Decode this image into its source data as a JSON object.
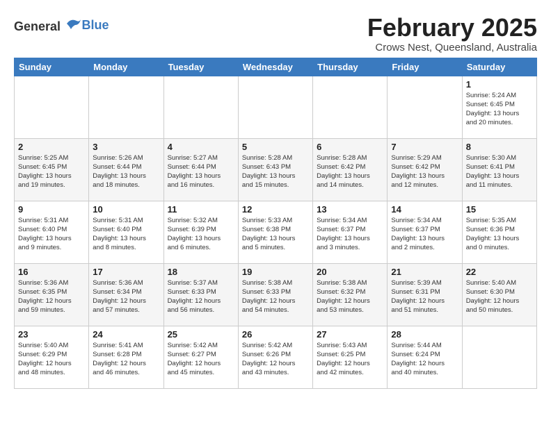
{
  "header": {
    "logo_general": "General",
    "logo_blue": "Blue",
    "month": "February 2025",
    "location": "Crows Nest, Queensland, Australia"
  },
  "columns": [
    "Sunday",
    "Monday",
    "Tuesday",
    "Wednesday",
    "Thursday",
    "Friday",
    "Saturday"
  ],
  "weeks": [
    [
      {
        "day": "",
        "detail": ""
      },
      {
        "day": "",
        "detail": ""
      },
      {
        "day": "",
        "detail": ""
      },
      {
        "day": "",
        "detail": ""
      },
      {
        "day": "",
        "detail": ""
      },
      {
        "day": "",
        "detail": ""
      },
      {
        "day": "1",
        "detail": "Sunrise: 5:24 AM\nSunset: 6:45 PM\nDaylight: 13 hours\nand 20 minutes."
      }
    ],
    [
      {
        "day": "2",
        "detail": "Sunrise: 5:25 AM\nSunset: 6:45 PM\nDaylight: 13 hours\nand 19 minutes."
      },
      {
        "day": "3",
        "detail": "Sunrise: 5:26 AM\nSunset: 6:44 PM\nDaylight: 13 hours\nand 18 minutes."
      },
      {
        "day": "4",
        "detail": "Sunrise: 5:27 AM\nSunset: 6:44 PM\nDaylight: 13 hours\nand 16 minutes."
      },
      {
        "day": "5",
        "detail": "Sunrise: 5:28 AM\nSunset: 6:43 PM\nDaylight: 13 hours\nand 15 minutes."
      },
      {
        "day": "6",
        "detail": "Sunrise: 5:28 AM\nSunset: 6:42 PM\nDaylight: 13 hours\nand 14 minutes."
      },
      {
        "day": "7",
        "detail": "Sunrise: 5:29 AM\nSunset: 6:42 PM\nDaylight: 13 hours\nand 12 minutes."
      },
      {
        "day": "8",
        "detail": "Sunrise: 5:30 AM\nSunset: 6:41 PM\nDaylight: 13 hours\nand 11 minutes."
      }
    ],
    [
      {
        "day": "9",
        "detail": "Sunrise: 5:31 AM\nSunset: 6:40 PM\nDaylight: 13 hours\nand 9 minutes."
      },
      {
        "day": "10",
        "detail": "Sunrise: 5:31 AM\nSunset: 6:40 PM\nDaylight: 13 hours\nand 8 minutes."
      },
      {
        "day": "11",
        "detail": "Sunrise: 5:32 AM\nSunset: 6:39 PM\nDaylight: 13 hours\nand 6 minutes."
      },
      {
        "day": "12",
        "detail": "Sunrise: 5:33 AM\nSunset: 6:38 PM\nDaylight: 13 hours\nand 5 minutes."
      },
      {
        "day": "13",
        "detail": "Sunrise: 5:34 AM\nSunset: 6:37 PM\nDaylight: 13 hours\nand 3 minutes."
      },
      {
        "day": "14",
        "detail": "Sunrise: 5:34 AM\nSunset: 6:37 PM\nDaylight: 13 hours\nand 2 minutes."
      },
      {
        "day": "15",
        "detail": "Sunrise: 5:35 AM\nSunset: 6:36 PM\nDaylight: 13 hours\nand 0 minutes."
      }
    ],
    [
      {
        "day": "16",
        "detail": "Sunrise: 5:36 AM\nSunset: 6:35 PM\nDaylight: 12 hours\nand 59 minutes."
      },
      {
        "day": "17",
        "detail": "Sunrise: 5:36 AM\nSunset: 6:34 PM\nDaylight: 12 hours\nand 57 minutes."
      },
      {
        "day": "18",
        "detail": "Sunrise: 5:37 AM\nSunset: 6:33 PM\nDaylight: 12 hours\nand 56 minutes."
      },
      {
        "day": "19",
        "detail": "Sunrise: 5:38 AM\nSunset: 6:33 PM\nDaylight: 12 hours\nand 54 minutes."
      },
      {
        "day": "20",
        "detail": "Sunrise: 5:38 AM\nSunset: 6:32 PM\nDaylight: 12 hours\nand 53 minutes."
      },
      {
        "day": "21",
        "detail": "Sunrise: 5:39 AM\nSunset: 6:31 PM\nDaylight: 12 hours\nand 51 minutes."
      },
      {
        "day": "22",
        "detail": "Sunrise: 5:40 AM\nSunset: 6:30 PM\nDaylight: 12 hours\nand 50 minutes."
      }
    ],
    [
      {
        "day": "23",
        "detail": "Sunrise: 5:40 AM\nSunset: 6:29 PM\nDaylight: 12 hours\nand 48 minutes."
      },
      {
        "day": "24",
        "detail": "Sunrise: 5:41 AM\nSunset: 6:28 PM\nDaylight: 12 hours\nand 46 minutes."
      },
      {
        "day": "25",
        "detail": "Sunrise: 5:42 AM\nSunset: 6:27 PM\nDaylight: 12 hours\nand 45 minutes."
      },
      {
        "day": "26",
        "detail": "Sunrise: 5:42 AM\nSunset: 6:26 PM\nDaylight: 12 hours\nand 43 minutes."
      },
      {
        "day": "27",
        "detail": "Sunrise: 5:43 AM\nSunset: 6:25 PM\nDaylight: 12 hours\nand 42 minutes."
      },
      {
        "day": "28",
        "detail": "Sunrise: 5:44 AM\nSunset: 6:24 PM\nDaylight: 12 hours\nand 40 minutes."
      },
      {
        "day": "",
        "detail": ""
      }
    ]
  ]
}
